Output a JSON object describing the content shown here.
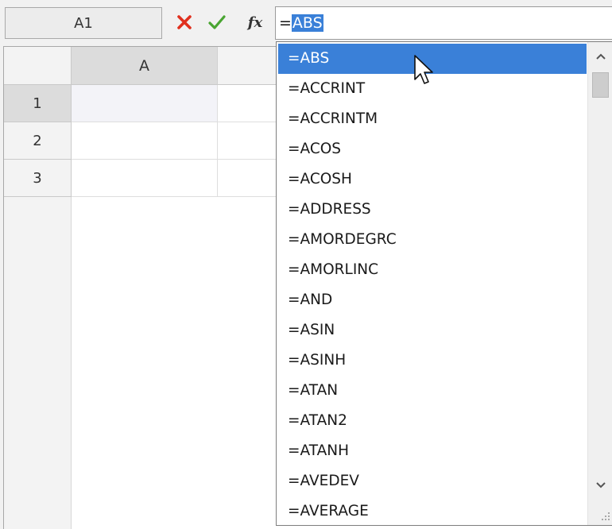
{
  "formula_bar": {
    "name_box": "A1",
    "cancel_icon": "close-icon",
    "enter_icon": "check-icon",
    "fx_label": "fx",
    "formula_prefix": "=",
    "formula_selected": "ABS"
  },
  "grid": {
    "columns": [
      "A"
    ],
    "rows": [
      "1",
      "2",
      "3"
    ]
  },
  "autocomplete": {
    "items": [
      "=ABS",
      "=ACCRINT",
      "=ACCRINTM",
      "=ACOS",
      "=ACOSH",
      "=ADDRESS",
      "=AMORDEGRC",
      "=AMORLINC",
      "=AND",
      "=ASIN",
      "=ASINH",
      "=ATAN",
      "=ATAN2",
      "=ATANH",
      "=AVEDEV",
      "=AVERAGE"
    ],
    "active_index": 0
  },
  "colors": {
    "selection": "#3a80d8",
    "cancel": "#e0301e",
    "confirm": "#49a531"
  }
}
